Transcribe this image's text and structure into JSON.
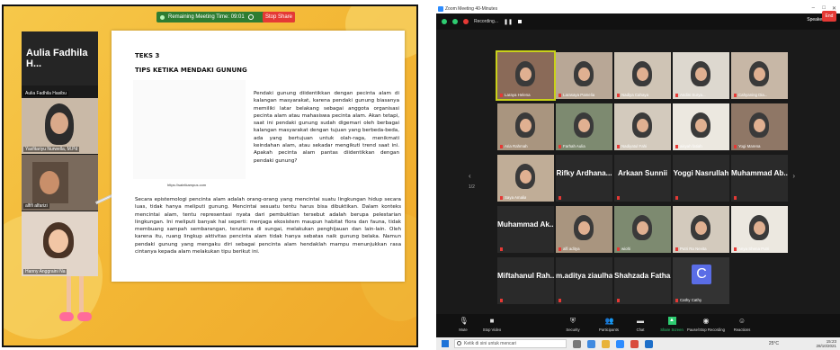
{
  "left": {
    "share_bar": {
      "timer_text": "Remaining Meeting Time: 09:01",
      "stop_share": "Stop Share"
    },
    "gallery": {
      "big_name": "Aulia Fadhila H...",
      "tiles": [
        {
          "label": "Aulia Fadhila Hasibu"
        },
        {
          "label": "Yasfitariyu Nurwella, M.Pd"
        },
        {
          "label": "alfifi alfarizi"
        },
        {
          "label": "Hanny Anggraini Na"
        }
      ]
    },
    "slide": {
      "title1": "TEKS 3",
      "title2": "TIPS KETIKA MENDAKI GUNUNG",
      "url": "https://saintkampus.com",
      "para1": "Pendaki gunung diidentikkan dengan pecinta alam di kalangan masyarakat, karena pendaki gunung biasanya memiliki latar belakang sebagai anggota organisasi pecinta alam atau mahasiswa pecinta alam. Akan tetapi, saat ini pendaki gunung sudah digemari oleh berbagai kalangan masyarakat dengan tujuan yang berbeda-beda, ada yang bertujuan untuk olah-raga, menikmati keindahan alam, atau sekadar mengikuti trend saat ini. Apakah pecinta alam pantas diidentikkan dengan pendaki gunung?",
      "para2": "Secara epistemologi pencinta alam adalah orang-orang yang mencintai suatu lingkungan hidup secara luas, tidak hanya meliputi gunung. Mencintai sesuatu tentu harus bisa dibuktikan. Dalam konteks mencintai alam, tentu representasi nyata dari pembuktian tersebut adalah berupa pelestarian lingkungan. Ini meliputi banyak hal seperti: menjaga ekosistem maupun habitat flora dan fauna, tidak membuang sampah sembarangan, terutama di sungai, melakukan penghijauan dan lain-lain. Oleh karena itu, ruang lingkup aktivitas pencinta alam tidak hanya sebatas naik gunung belaka. Namun pendaki gunung yang mengaku diri sebagai pencinta alam hendaklah mampu menunjukkan rasa cintanya kepada alam melakukan tipu berikut ini."
    }
  },
  "right": {
    "window_title": "Zoom Meeting 40-Minutes",
    "meeting_bar": {
      "recording": "Recording...",
      "speaker_view": "Speaker View"
    },
    "colors": {
      "active_outline": "#c9d11a",
      "end_button": "#e53935",
      "avatar_c": "#5a6de6"
    },
    "tiles": [
      {
        "name": "Laraya Helena",
        "active": true
      },
      {
        "name": "Larasaya Pamelia"
      },
      {
        "name": "Nadiya Cahaya"
      },
      {
        "name": "Andini Surya..."
      },
      {
        "name": "Cahyaning Dia..."
      },
      {
        "name": "Aria Rahmah"
      },
      {
        "name": "Farhah Aulia"
      },
      {
        "name": "Nadiyatul Fahi"
      },
      {
        "name": "aisyah fatiah"
      },
      {
        "name": "Yogi Marena"
      },
      {
        "name": "Saya Amalia"
      },
      {
        "name": "Rifky Ardhana...",
        "big": "Rifky Ardhana..."
      },
      {
        "name": "Arkaan Sunnii",
        "big": "Arkaan Sunnii"
      },
      {
        "name": "Yoggi Nasrullah",
        "big": "Yoggi Nasrullah"
      },
      {
        "name": "Muhammad Ab...",
        "big": "Muhammad Ab..."
      },
      {
        "name": "Muhammad Ak...",
        "big": "Muhammad Ak..."
      },
      {
        "name": "alfi aditya"
      },
      {
        "name": "wiolti"
      },
      {
        "name": "Putri Ra Nevita"
      },
      {
        "name": "Anya Shena Putri"
      },
      {
        "name": "Miftahanul Rah...",
        "big": "Miftahanul Rah..."
      },
      {
        "name": "m.aditya ziaulhaq",
        "big": "m.aditya ziaulhaq"
      },
      {
        "name": "Shahzada Fatha...",
        "big": "Shahzada Fatha..."
      },
      {
        "name": "Cathy Cathy",
        "avatar": "C"
      }
    ],
    "page_indicator": "1/2",
    "toolbar": [
      {
        "label": "Mute",
        "icon": "mic-icon"
      },
      {
        "label": "Stop Video",
        "icon": "video-icon"
      },
      {
        "label": "Security",
        "icon": "shield-icon"
      },
      {
        "label": "Participants",
        "icon": "people-icon"
      },
      {
        "label": "Chat",
        "icon": "chat-icon"
      },
      {
        "label": "Share Screen",
        "icon": "share-icon"
      },
      {
        "label": "Pause/Stop Recording",
        "icon": "record-icon"
      },
      {
        "label": "Reactions",
        "icon": "smile-icon"
      }
    ],
    "end_label": "End",
    "taskbar": {
      "search_placeholder": "Ketik di sini untuk mencari",
      "weather": "25°C",
      "time": "15:23",
      "date": "28/10/2021"
    }
  }
}
